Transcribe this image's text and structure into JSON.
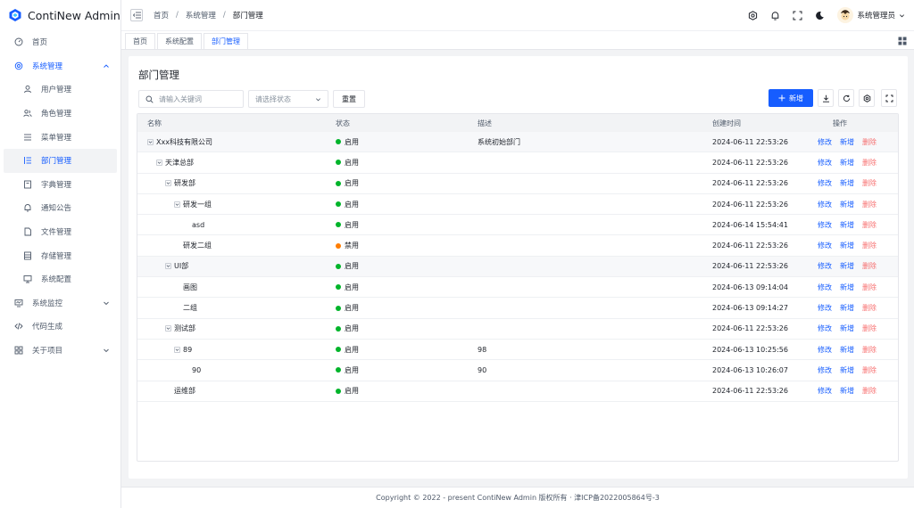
{
  "app": {
    "title": "ContiNew Admin"
  },
  "sidebar": {
    "items": [
      {
        "label": "首页",
        "icon": "dashboard-icon"
      },
      {
        "label": "系统管理",
        "icon": "settings-icon"
      },
      {
        "label": "用户管理",
        "icon": "user-icon"
      },
      {
        "label": "角色管理",
        "icon": "users-icon"
      },
      {
        "label": "菜单管理",
        "icon": "menu-icon"
      },
      {
        "label": "部门管理",
        "icon": "tree-icon"
      },
      {
        "label": "字典管理",
        "icon": "book-icon"
      },
      {
        "label": "通知公告",
        "icon": "bell-icon"
      },
      {
        "label": "文件管理",
        "icon": "file-icon"
      },
      {
        "label": "存储管理",
        "icon": "storage-icon"
      },
      {
        "label": "系统配置",
        "icon": "desktop-icon"
      },
      {
        "label": "系统监控",
        "icon": "monitor-icon"
      },
      {
        "label": "代码生成",
        "icon": "code-icon"
      },
      {
        "label": "关于项目",
        "icon": "apps-icon"
      }
    ]
  },
  "header": {
    "breadcrumb": [
      "首页",
      "系统管理",
      "部门管理"
    ],
    "user_name": "系统管理员"
  },
  "tabs": [
    {
      "label": "首页"
    },
    {
      "label": "系统配置"
    },
    {
      "label": "部门管理"
    }
  ],
  "main": {
    "title": "部门管理",
    "search_placeholder": "请输入关键词",
    "status_placeholder": "请选择状态",
    "reset_label": "重置",
    "add_label": "新增"
  },
  "table": {
    "columns": [
      "名称",
      "状态",
      "描述",
      "创建时间",
      "操作"
    ],
    "ops": [
      "修改",
      "新增",
      "删除"
    ],
    "rows": [
      {
        "name": "Xxx科技有限公司",
        "level": 0,
        "expandable": true,
        "status": "启用",
        "enabled": true,
        "desc": "系统初始部门",
        "time": "2024-06-11 22:53:26"
      },
      {
        "name": "天津总部",
        "level": 1,
        "expandable": true,
        "status": "启用",
        "enabled": true,
        "desc": "",
        "time": "2024-06-11 22:53:26"
      },
      {
        "name": "研发部",
        "level": 2,
        "expandable": true,
        "status": "启用",
        "enabled": true,
        "desc": "",
        "time": "2024-06-11 22:53:26"
      },
      {
        "name": "研发一组",
        "level": 3,
        "expandable": true,
        "status": "启用",
        "enabled": true,
        "desc": "",
        "time": "2024-06-11 22:53:26"
      },
      {
        "name": "asd",
        "level": 4,
        "expandable": false,
        "status": "启用",
        "enabled": true,
        "desc": "",
        "time": "2024-06-14 15:54:41"
      },
      {
        "name": "研发二组",
        "level": 3,
        "expandable": false,
        "status": "禁用",
        "enabled": false,
        "desc": "",
        "time": "2024-06-11 22:53:26"
      },
      {
        "name": "UI部",
        "level": 2,
        "expandable": true,
        "status": "启用",
        "enabled": true,
        "desc": "",
        "time": "2024-06-11 22:53:26"
      },
      {
        "name": "画图",
        "level": 3,
        "expandable": false,
        "status": "启用",
        "enabled": true,
        "desc": "",
        "time": "2024-06-13 09:14:04"
      },
      {
        "name": "二组",
        "level": 3,
        "expandable": false,
        "status": "启用",
        "enabled": true,
        "desc": "",
        "time": "2024-06-13 09:14:27"
      },
      {
        "name": "测试部",
        "level": 2,
        "expandable": true,
        "status": "启用",
        "enabled": true,
        "desc": "",
        "time": "2024-06-11 22:53:26"
      },
      {
        "name": "89",
        "level": 3,
        "expandable": true,
        "status": "启用",
        "enabled": true,
        "desc": "98",
        "time": "2024-06-13 10:25:56"
      },
      {
        "name": "90",
        "level": 4,
        "expandable": false,
        "status": "启用",
        "enabled": true,
        "desc": "90",
        "time": "2024-06-13 10:26:07"
      },
      {
        "name": "运维部",
        "level": 2,
        "expandable": false,
        "status": "启用",
        "enabled": true,
        "desc": "",
        "time": "2024-06-11 22:53:26"
      }
    ]
  },
  "footer": {
    "text": "Copyright © 2022 - present ContiNew Admin 版权所有 · 津ICP备2022005864号-3"
  },
  "colors": {
    "primary": "#165dff",
    "success": "#00b42a",
    "warning": "#ff7d00",
    "danger": "#f53f3f"
  }
}
